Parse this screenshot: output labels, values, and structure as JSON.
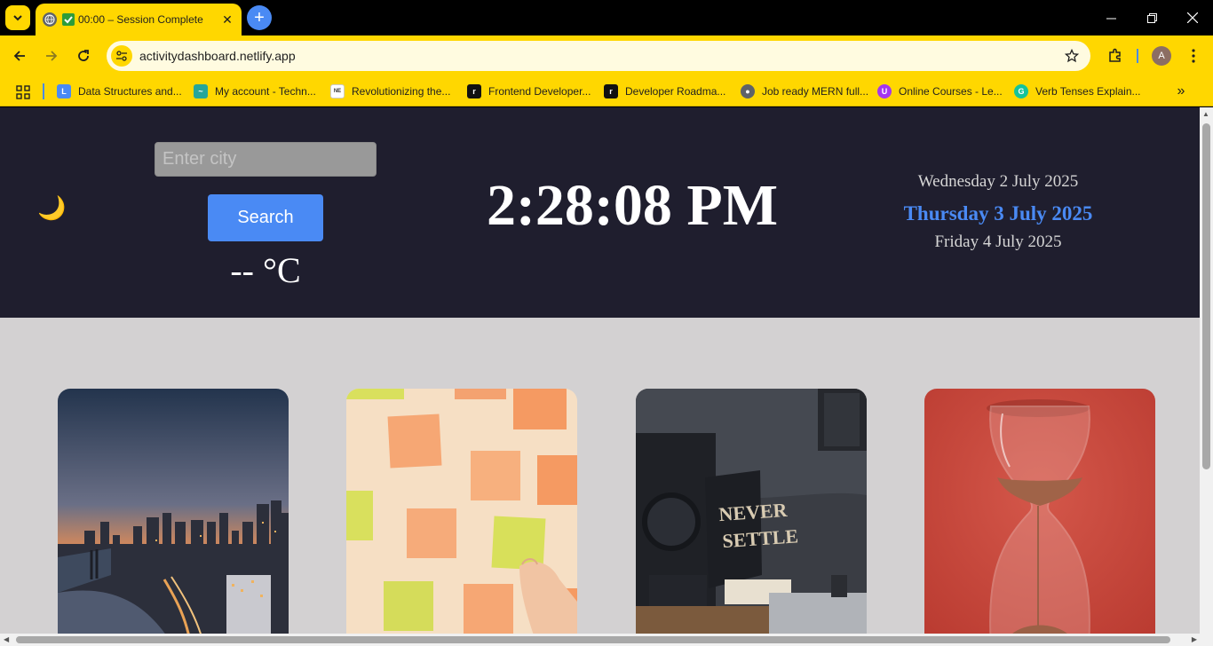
{
  "browser": {
    "tab": {
      "title": "00:00 – Session Complete",
      "status_icon": "check-emoji-icon"
    },
    "address": "activitydashboard.netlify.app",
    "profile_initial": "A",
    "bookmarks": [
      {
        "label": "Data Structures and...",
        "icon": "lc-icon",
        "color": "#4a8af4"
      },
      {
        "label": "My account - Techn...",
        "icon": "tech-icon",
        "color": "#26a69a"
      },
      {
        "label": "Revolutionizing the...",
        "icon": "news-icon",
        "color": "#ffffff"
      },
      {
        "label": "Frontend Developer...",
        "icon": "roadmap-icon",
        "color": "#111111"
      },
      {
        "label": "Developer Roadma...",
        "icon": "roadmap-icon",
        "color": "#111111"
      },
      {
        "label": "Job ready MERN full...",
        "icon": "globe-icon",
        "color": "#5f6368"
      },
      {
        "label": "Online Courses - Le...",
        "icon": "udemy-icon",
        "color": "#a435f0"
      },
      {
        "label": "Verb Tenses Explain...",
        "icon": "grammarly-icon",
        "color": "#15c39a"
      }
    ]
  },
  "dashboard": {
    "theme_toggle_icon": "🌙",
    "search": {
      "placeholder": "Enter city",
      "button_label": "Search"
    },
    "temperature": "-- °C",
    "clock": "2:28:08 PM",
    "dates": {
      "previous": "Wednesday 2 July 2025",
      "current": "Thursday 3 July 2025",
      "next": "Friday 4 July 2025"
    },
    "accent_color": "#4a8af4",
    "cards": [
      {
        "name": "city-skyline-card",
        "subject": "city skyline at sunset"
      },
      {
        "name": "sticky-notes-card",
        "subject": "sticky notes on wall"
      },
      {
        "name": "never-settle-card",
        "subject": "never settle sign"
      },
      {
        "name": "hourglass-card",
        "subject": "hourglass on red"
      }
    ]
  }
}
